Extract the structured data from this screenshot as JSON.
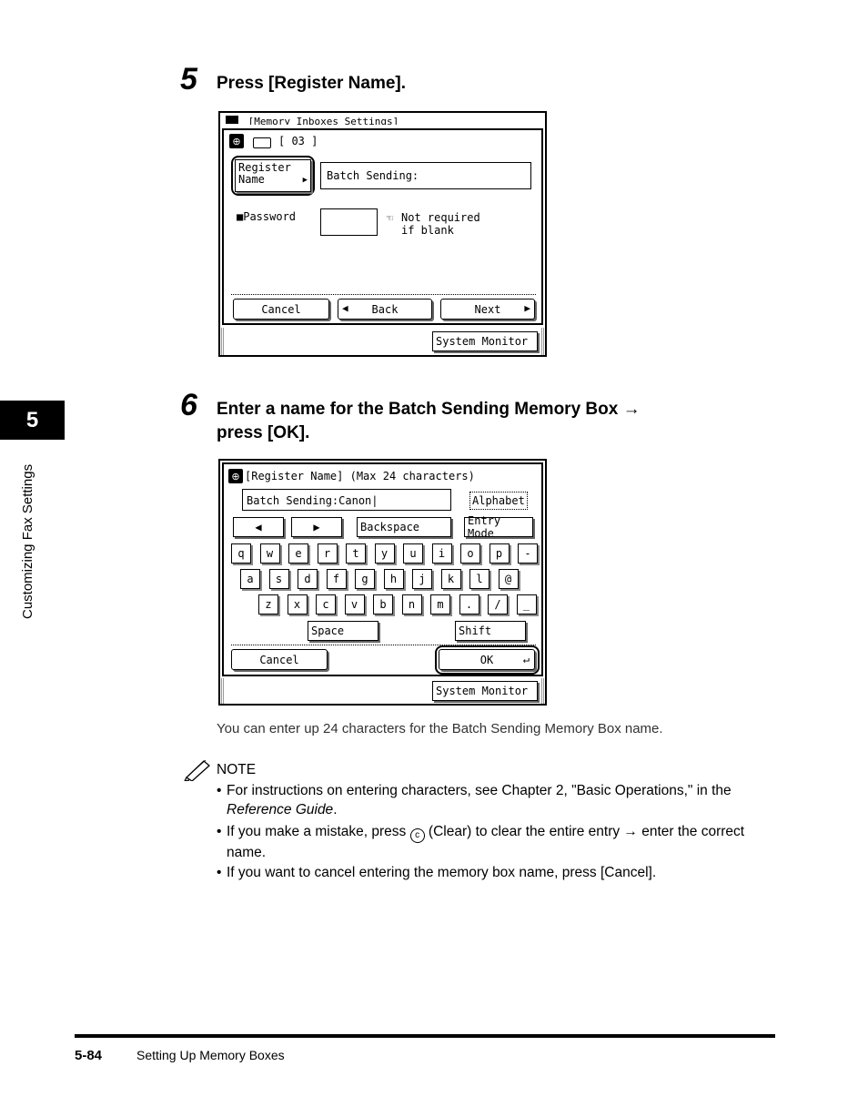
{
  "chapter": {
    "number": "5",
    "title": "Customizing Fax Settings"
  },
  "step5": {
    "number": "5",
    "text": "Press [Register Name].",
    "screen": {
      "titlebar": "[Memory Inboxes Settings]",
      "box_number": "[ 03 ]",
      "register_button": [
        "Register",
        "Name"
      ],
      "name_value": "Batch Sending:",
      "password_label": "Password",
      "password_hint": [
        "Not required",
        "if blank"
      ],
      "cancel": "Cancel",
      "back": "Back",
      "next": "Next",
      "system_monitor": "System Monitor"
    }
  },
  "step6": {
    "number": "6",
    "text_line1": "Enter a name for the Batch Sending Memory Box →",
    "text_line2": "press [OK].",
    "screen": {
      "title": "[Register Name] (Max 24 characters)",
      "input_value": "Batch Sending:Canon",
      "mode": "Alphabet",
      "left_arrow": "◀",
      "right_arrow": "▶",
      "backspace": "Backspace",
      "entry_mode": "Entry Mode",
      "row1": [
        "q",
        "w",
        "e",
        "r",
        "t",
        "y",
        "u",
        "i",
        "o",
        "p",
        "-"
      ],
      "row2": [
        "a",
        "s",
        "d",
        "f",
        "g",
        "h",
        "j",
        "k",
        "l",
        "@"
      ],
      "row3": [
        "z",
        "x",
        "c",
        "v",
        "b",
        "n",
        "m",
        ".",
        "/",
        "_"
      ],
      "space": "Space",
      "shift": "Shift",
      "cancel": "Cancel",
      "ok": "OK",
      "system_monitor": "System Monitor"
    }
  },
  "caption": "You can enter up 24 characters for the Batch Sending Memory Box name.",
  "note": {
    "heading": "NOTE",
    "item1_a": "For instructions on entering characters, see Chapter 2, \"Basic Operations,\" in the",
    "item1_b": "Reference Guide",
    "item1_c": ".",
    "item2_a": "If you make a mistake, press",
    "item2_icon": "c",
    "item2_b": "(Clear) to clear the entire entry → enter the correct",
    "item2_c": "name.",
    "item3": "If you want to cancel entering the memory box name, press [Cancel]."
  },
  "footer": {
    "page": "5-84",
    "section": "Setting Up Memory Boxes"
  }
}
